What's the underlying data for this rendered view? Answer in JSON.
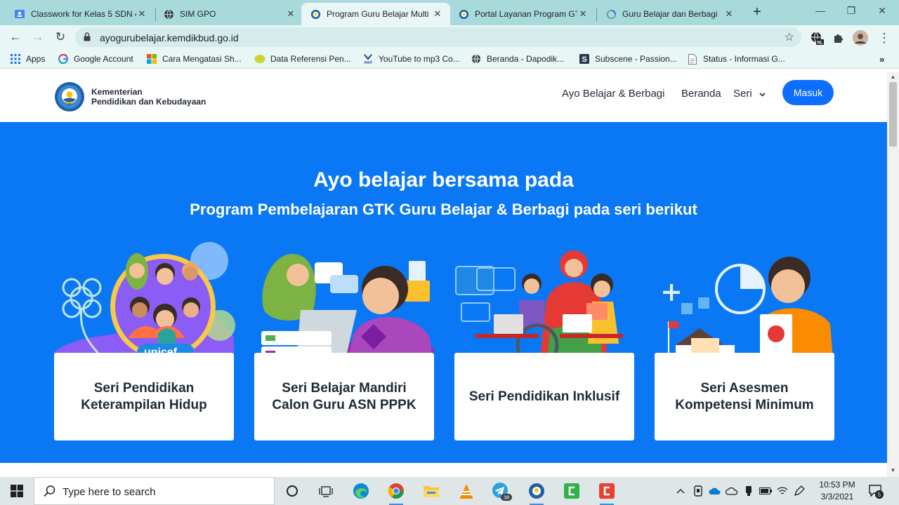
{
  "browser": {
    "tabs": [
      {
        "label": "Classwork for Kelas 5 SDN 4",
        "icon": "google-classroom-icon",
        "active": false
      },
      {
        "label": "SIM GPO",
        "icon": "globe-icon",
        "active": false
      },
      {
        "label": "Program Guru Belajar Multi",
        "icon": "kemdikbud-icon",
        "active": true
      },
      {
        "label": "Portal Layanan Program GT",
        "icon": "kemdikbud-icon",
        "active": false
      },
      {
        "label": "Guru Belajar dan Berbagi",
        "icon": "loading-icon",
        "active": false
      }
    ],
    "url": "ayogurubelajar.kemdikbud.go.id",
    "bookmarks": [
      {
        "label": "Apps",
        "icon": "apps-grid-icon"
      },
      {
        "label": "Google Account",
        "icon": "google-icon"
      },
      {
        "label": "Cara Mengatasi Sh...",
        "icon": "microsoft-icon"
      },
      {
        "label": "Data Referensi Pen...",
        "icon": "data-ref-icon"
      },
      {
        "label": "YouTube to mp3 Co...",
        "icon": "yt-mp3-icon"
      },
      {
        "label": "Beranda - Dapodik...",
        "icon": "globe-icon"
      },
      {
        "label": "Subscene - Passion...",
        "icon": "subscene-icon"
      },
      {
        "label": "Status - Informasi G...",
        "icon": "document-icon"
      }
    ],
    "extension_badge": "NL"
  },
  "site": {
    "org_line1": "Kementerian",
    "org_line2": "Pendidikan dan Kebudayaan",
    "nav": {
      "ayo_belajar": "Ayo Belajar & Berbagi",
      "beranda": "Beranda",
      "seri": "Seri",
      "masuk": "Masuk"
    },
    "hero_title": "Ayo belajar bersama pada",
    "hero_subtitle": "Program Pembelajaran GTK Guru Belajar & Berbagi pada seri berikut",
    "cards": [
      {
        "title": "Seri Pendidikan Keterampilan Hidup",
        "badge": "unicef"
      },
      {
        "title": "Seri Belajar Mandiri Calon Guru ASN PPPK"
      },
      {
        "title": "Seri Pendidikan Inklusif"
      },
      {
        "title": "Seri Asesmen Kompetensi Minimum"
      }
    ],
    "colors": {
      "hero_blue": "#0a78f5",
      "button_blue": "#0d6efd"
    }
  },
  "taskbar": {
    "search_placeholder": "Type here to search",
    "time": "10:53 PM",
    "date": "3/3/2021",
    "telegram_badge": "38",
    "notification_count": "5"
  }
}
